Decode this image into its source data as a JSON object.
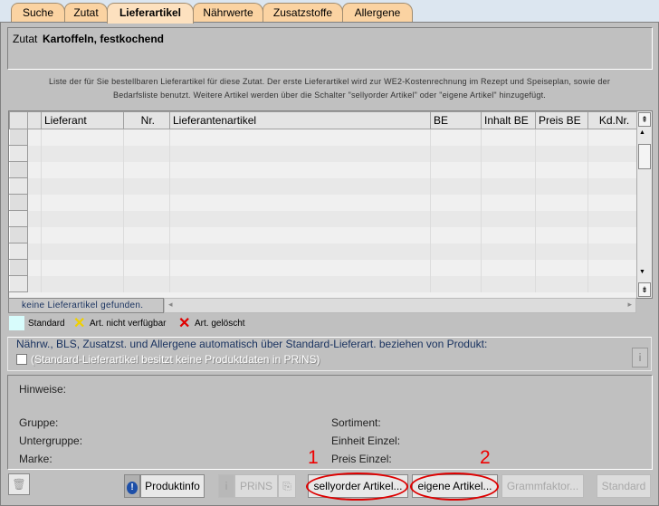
{
  "tabs": [
    "Suche",
    "Zutat",
    "Lieferartikel",
    "Nährwerte",
    "Zusatzstoffe",
    "Allergene"
  ],
  "active_tab": "Lieferartikel",
  "zutat": {
    "label": "Zutat",
    "value": "Kartoffeln, festkochend"
  },
  "description": [
    "Liste der für Sie bestellbaren Lieferartikel für diese Zutat.  Der erste Lieferartikel wird zur WE2-Kostenrechnung im Rezept und Speiseplan, sowie der",
    "Bedarfsliste benutzt.  Weitere Artikel werden über die Schalter \"sellyorder Artikel\" oder \"eigene Artikel\" hinzugefügt."
  ],
  "table": {
    "columns": [
      "Lieferant",
      "Nr.",
      "Lieferantenartikel",
      "BE",
      "Inhalt BE",
      "Preis BE",
      "Kd.Nr."
    ],
    "rows": [],
    "status": "keine  Lieferartikel gefunden."
  },
  "legend": {
    "standard": "Standard",
    "unavailable": "Art. nicht verfügbar",
    "deleted": "Art. gelöscht",
    "colors": {
      "standard": "#d8fcfc",
      "unavailable": "#f0d000",
      "deleted": "#e00000"
    }
  },
  "auto": {
    "title": "Nährw., BLS, Zusatzst. und Allergene automatisch über Standard-Lieferart. beziehen von Produkt:",
    "checkbox_label": "(Standard-Lieferartikel besitzt keine Produktdaten in PRiNS)",
    "checked": false
  },
  "info": {
    "hinweise": "Hinweise:",
    "gruppe": "Gruppe:",
    "untergruppe": "Untergruppe:",
    "marke": "Marke:",
    "sortiment": "Sortiment:",
    "einheit": "Einheit Einzel:",
    "preis": "Preis Einzel:"
  },
  "buttons": {
    "produktinfo": "Produktinfo",
    "prins": "PRiNS",
    "sellyorder": "sellyorder Artikel...",
    "eigene": "eigene Artikel...",
    "grammfaktor": "Grammfaktor...",
    "standard": "Standard"
  },
  "annotations": [
    "1",
    "2"
  ]
}
